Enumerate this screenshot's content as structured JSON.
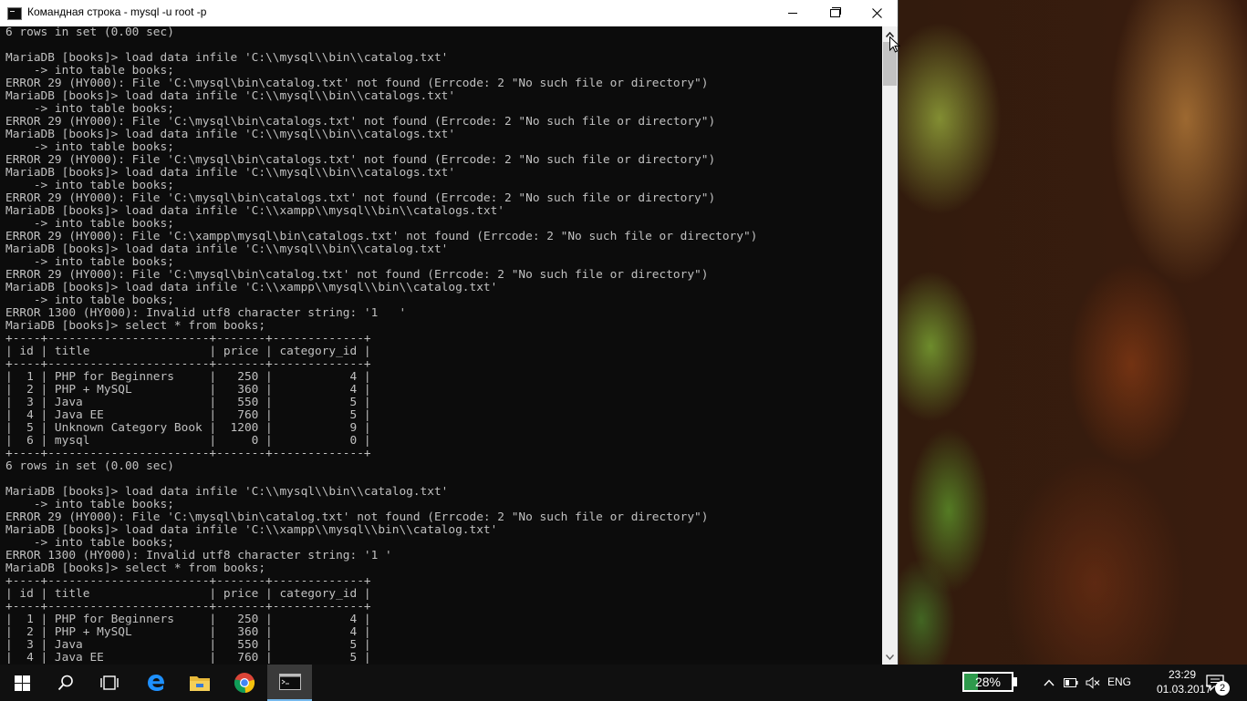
{
  "window": {
    "title": "Командная строка - mysql  -u root -p"
  },
  "console": {
    "lines": [
      "6 rows in set (0.00 sec)",
      "",
      "MariaDB [books]> load data infile 'C:\\\\mysql\\\\bin\\\\catalog.txt'",
      "    -> into table books;",
      "ERROR 29 (HY000): File 'C:\\mysql\\bin\\catalog.txt' not found (Errcode: 2 \"No such file or directory\")",
      "MariaDB [books]> load data infile 'C:\\\\mysql\\\\bin\\\\catalogs.txt'",
      "    -> into table books;",
      "ERROR 29 (HY000): File 'C:\\mysql\\bin\\catalogs.txt' not found (Errcode: 2 \"No such file or directory\")",
      "MariaDB [books]> load data infile 'C:\\\\mysql\\\\bin\\\\catalogs.txt'",
      "    -> into table books;",
      "ERROR 29 (HY000): File 'C:\\mysql\\bin\\catalogs.txt' not found (Errcode: 2 \"No such file or directory\")",
      "MariaDB [books]> load data infile 'C:\\\\mysql\\\\bin\\\\catalogs.txt'",
      "    -> into table books;",
      "ERROR 29 (HY000): File 'C:\\mysql\\bin\\catalogs.txt' not found (Errcode: 2 \"No such file or directory\")",
      "MariaDB [books]> load data infile 'C:\\\\xampp\\\\mysql\\\\bin\\\\catalogs.txt'",
      "    -> into table books;",
      "ERROR 29 (HY000): File 'C:\\xampp\\mysql\\bin\\catalogs.txt' not found (Errcode: 2 \"No such file or directory\")",
      "MariaDB [books]> load data infile 'C:\\\\mysql\\\\bin\\\\catalog.txt'",
      "    -> into table books;",
      "ERROR 29 (HY000): File 'C:\\mysql\\bin\\catalog.txt' not found (Errcode: 2 \"No such file or directory\")",
      "MariaDB [books]> load data infile 'C:\\\\xampp\\\\mysql\\\\bin\\\\catalog.txt'",
      "    -> into table books;",
      "ERROR 1300 (HY000): Invalid utf8 character string: '1   '",
      "MariaDB [books]> select * from books;",
      "+----+-----------------------+-------+-------------+",
      "| id | title                 | price | category_id |",
      "+----+-----------------------+-------+-------------+",
      "|  1 | PHP for Beginners     |   250 |           4 |",
      "|  2 | PHP + MySQL           |   360 |           4 |",
      "|  3 | Java                  |   550 |           5 |",
      "|  4 | Java EE               |   760 |           5 |",
      "|  5 | Unknown Category Book |  1200 |           9 |",
      "|  6 | mysql                 |     0 |           0 |",
      "+----+-----------------------+-------+-------------+",
      "6 rows in set (0.00 sec)",
      "",
      "MariaDB [books]> load data infile 'C:\\\\mysql\\\\bin\\\\catalog.txt'",
      "    -> into table books;",
      "ERROR 29 (HY000): File 'C:\\mysql\\bin\\catalog.txt' not found (Errcode: 2 \"No such file or directory\")",
      "MariaDB [books]> load data infile 'C:\\\\xampp\\\\mysql\\\\bin\\\\catalog.txt'",
      "    -> into table books;",
      "ERROR 1300 (HY000): Invalid utf8 character string: '1 '",
      "MariaDB [books]> select * from books;",
      "+----+-----------------------+-------+-------------+",
      "| id | title                 | price | category_id |",
      "+----+-----------------------+-------+-------------+",
      "|  1 | PHP for Beginners     |   250 |           4 |",
      "|  2 | PHP + MySQL           |   360 |           4 |",
      "|  3 | Java                  |   550 |           5 |",
      "|  4 | Java EE               |   760 |           5 |"
    ]
  },
  "taskbar": {
    "battery_percent": "28%",
    "battery_level": 0.28,
    "language": "ENG",
    "time": "23:29",
    "date": "01.03.2017",
    "notification_count": "2",
    "icons": [
      "windows-start-icon",
      "search-icon",
      "task-view-icon",
      "edge-icon",
      "file-explorer-icon",
      "chrome-icon",
      "command-prompt-icon"
    ]
  },
  "colors": {
    "console_bg": "#0c0c0c",
    "console_text": "#c0c0c0",
    "taskbar_bg": "#101010",
    "battery_fill": "#2e9a4c"
  }
}
